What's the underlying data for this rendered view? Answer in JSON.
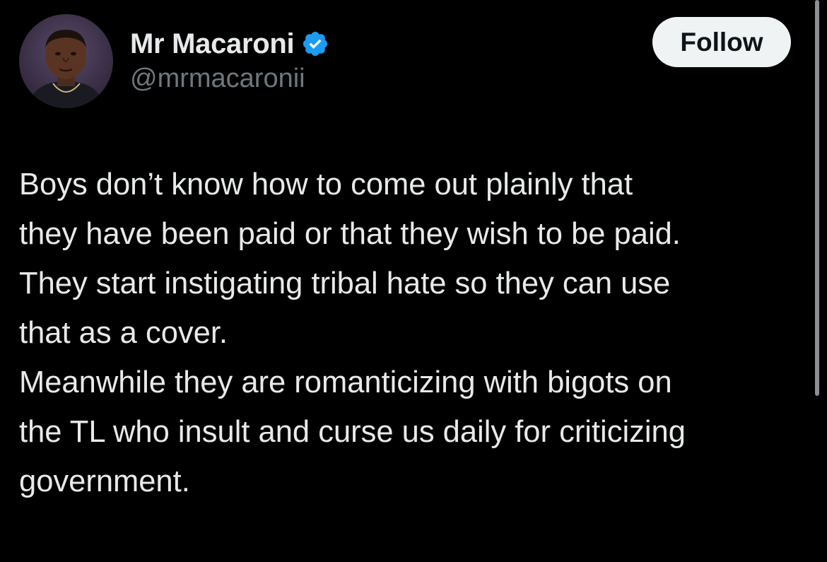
{
  "author": {
    "display_name": "Mr Macaroni",
    "handle": "@mrmacaronii",
    "verified_icon": "verified-badge-icon",
    "avatar_icon": "profile-photo"
  },
  "actions": {
    "follow_label": "Follow"
  },
  "tweet": {
    "lines": [
      "Boys don’t know how to come out plainly that",
      "they have been paid or that they wish to be paid.",
      "They start instigating tribal hate so they can use",
      "that as a cover.",
      "Meanwhile they are romanticizing with bigots on",
      "the TL who insult and curse us daily for criticizing",
      "government."
    ]
  },
  "colors": {
    "background": "#000000",
    "text_primary": "#e7e9ea",
    "text_secondary": "#71767b",
    "verified_blue": "#1d9bf0",
    "follow_bg": "#eff3f4"
  }
}
